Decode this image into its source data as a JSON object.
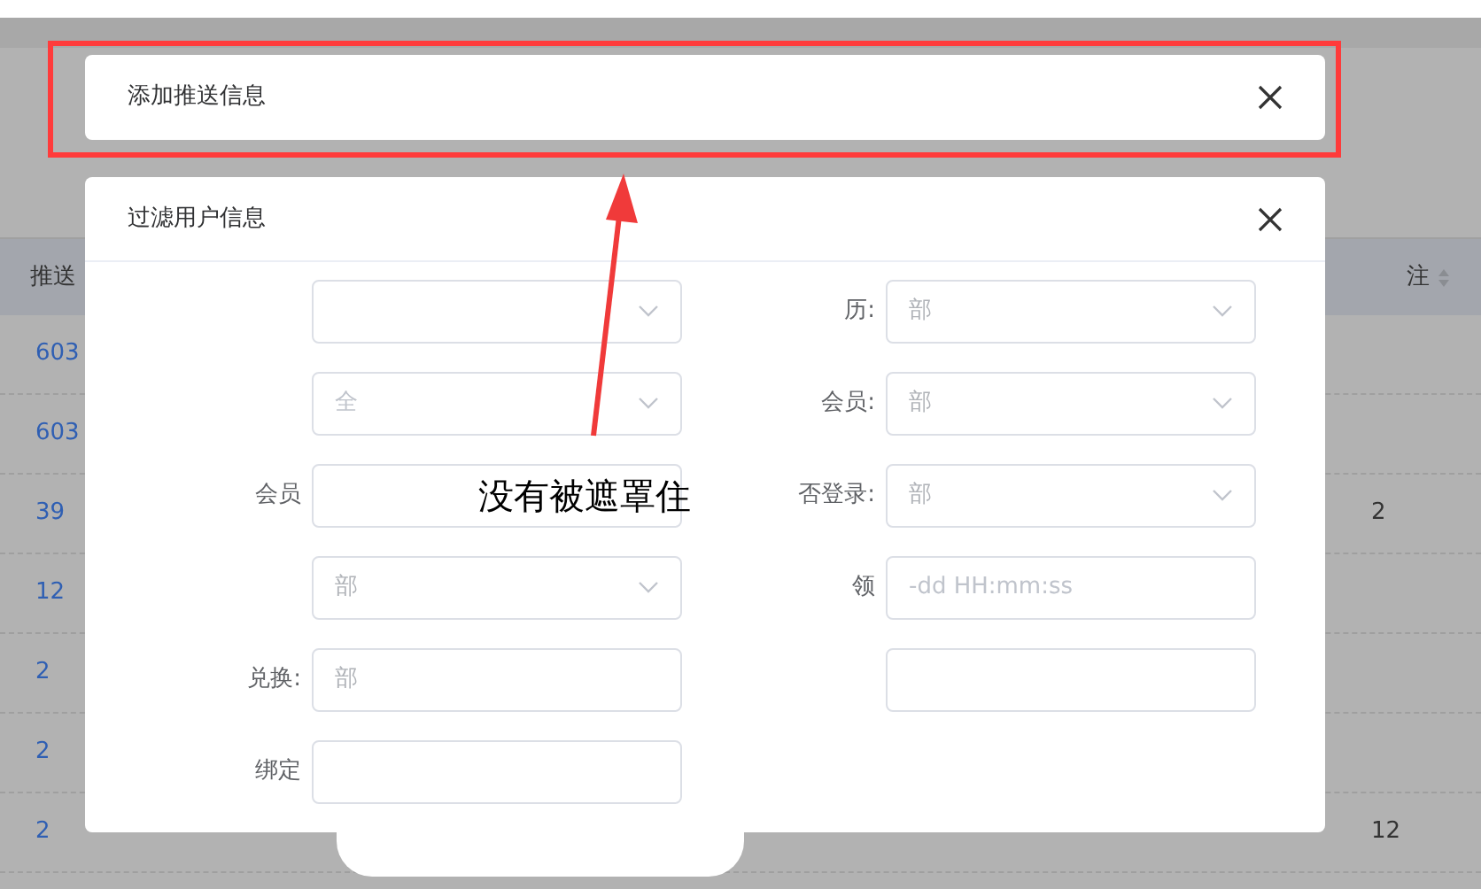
{
  "background_table": {
    "columns": [
      {
        "label": "推送"
      },
      {
        "label": "注"
      }
    ],
    "rows": [
      {
        "column_1": "603"
      },
      {
        "column_1": "603"
      },
      {
        "column_1": "39",
        "column_last": "2"
      },
      {
        "column_1": "12"
      },
      {
        "column_1": "2"
      },
      {
        "column_1": "2"
      },
      {
        "column_1": "2",
        "column_last": "12"
      }
    ]
  },
  "dialogs": [
    {
      "title": "添加推送信息"
    },
    {
      "title": "过滤用户信息",
      "fields": [
        {
          "kind": "select"
        },
        {
          "kind": "select",
          "label": "历:",
          "value": "部"
        },
        {
          "kind": "select",
          "placeholder": "全"
        },
        {
          "kind": "select",
          "label": "会员:",
          "value": "部"
        },
        {
          "kind": "input",
          "label": "会员"
        },
        {
          "kind": "select",
          "label": "否登录:",
          "value": "部"
        },
        {
          "kind": "select",
          "value": "部"
        },
        {
          "kind": "input",
          "label": "领",
          "placeholder": "-dd HH:mm:ss"
        },
        {
          "kind": "input",
          "label": "兑换:",
          "value": "部"
        },
        {
          "kind": "input"
        },
        {
          "kind": "input",
          "label": "绑定"
        }
      ]
    }
  ],
  "annotation": {
    "text": "没有被遮罩住"
  }
}
